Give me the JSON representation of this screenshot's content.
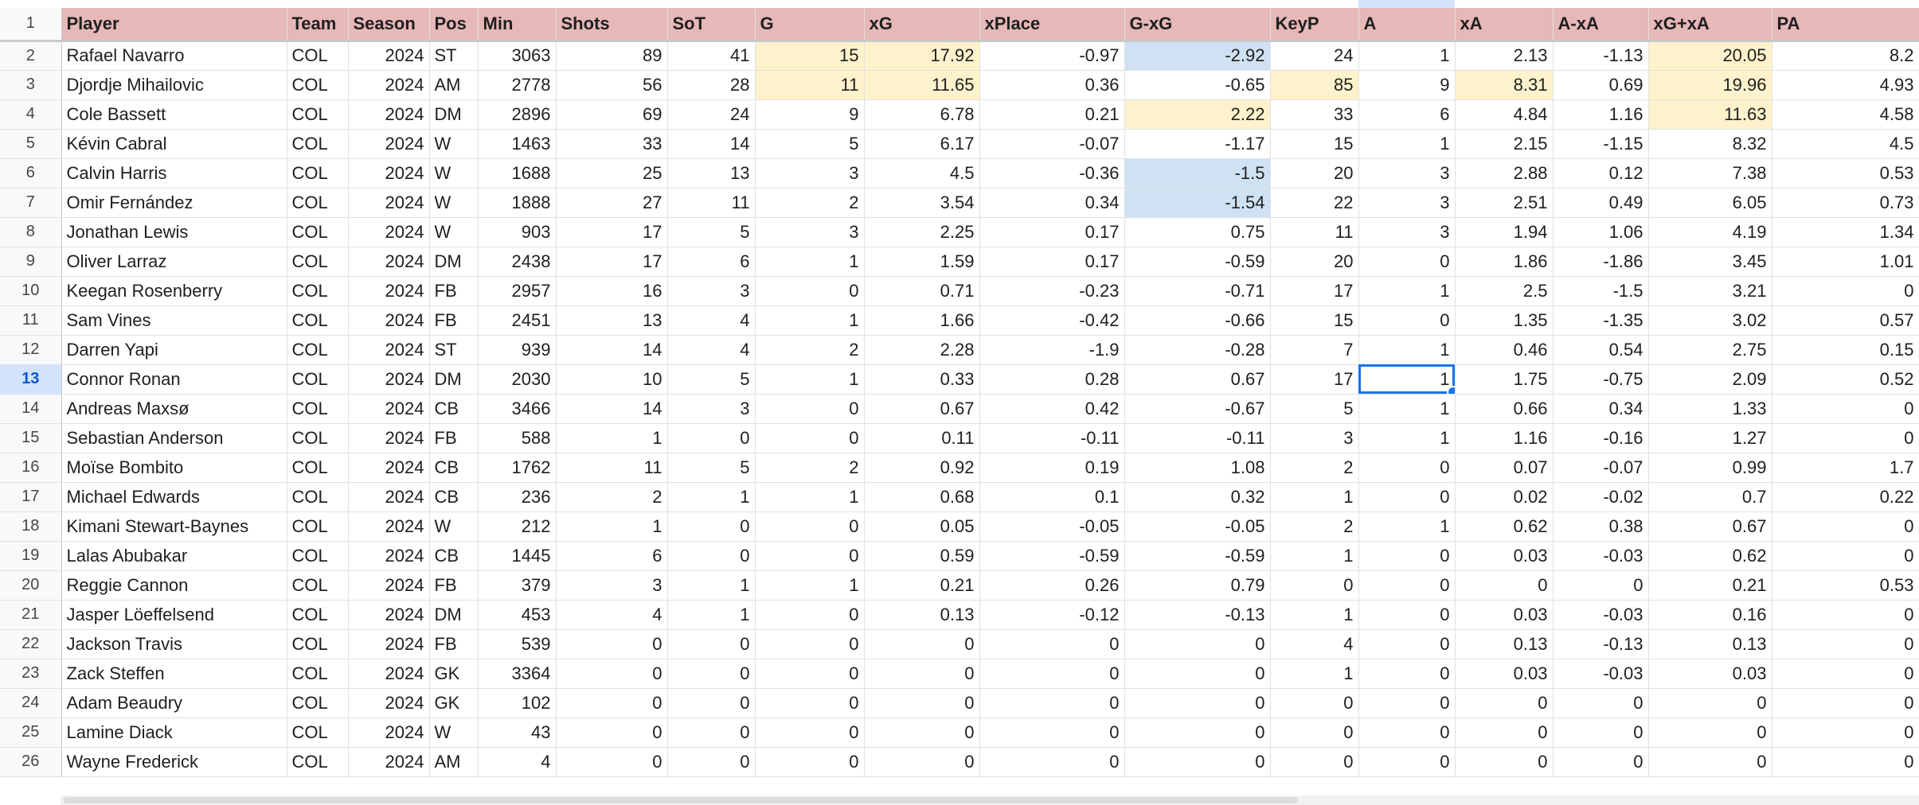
{
  "headers": [
    "Player",
    "Team",
    "Season",
    "Pos",
    "Min",
    "Shots",
    "SoT",
    "G",
    "xG",
    "xPlace",
    "G-xG",
    "KeyP",
    "A",
    "xA",
    "A-xA",
    "xG+xA",
    "PA"
  ],
  "header_row_number": "1",
  "active_row": "13",
  "selected_cell": {
    "row": "13",
    "column": "A"
  },
  "highlight_colors": {
    "header": "#e6b8b7",
    "yellow": "#fdf2cc",
    "blue": "#cfe2f3",
    "selection": "#1a73e8"
  },
  "rows": [
    {
      "num": "2",
      "cells": [
        "Rafael Navarro",
        "COL",
        "2024",
        "ST",
        "3063",
        "89",
        "41",
        "15",
        "17.92",
        "-0.97",
        "-2.92",
        "24",
        "1",
        "2.13",
        "-1.13",
        "20.05",
        "8.2"
      ]
    },
    {
      "num": "3",
      "cells": [
        "Djordje Mihailovic",
        "COL",
        "2024",
        "AM",
        "2778",
        "56",
        "28",
        "11",
        "11.65",
        "0.36",
        "-0.65",
        "85",
        "9",
        "8.31",
        "0.69",
        "19.96",
        "4.93"
      ]
    },
    {
      "num": "4",
      "cells": [
        "Cole Bassett",
        "COL",
        "2024",
        "DM",
        "2896",
        "69",
        "24",
        "9",
        "6.78",
        "0.21",
        "2.22",
        "33",
        "6",
        "4.84",
        "1.16",
        "11.63",
        "4.58"
      ]
    },
    {
      "num": "5",
      "cells": [
        "Kévin Cabral",
        "COL",
        "2024",
        "W",
        "1463",
        "33",
        "14",
        "5",
        "6.17",
        "-0.07",
        "-1.17",
        "15",
        "1",
        "2.15",
        "-1.15",
        "8.32",
        "4.5"
      ]
    },
    {
      "num": "6",
      "cells": [
        "Calvin Harris",
        "COL",
        "2024",
        "W",
        "1688",
        "25",
        "13",
        "3",
        "4.5",
        "-0.36",
        "-1.5",
        "20",
        "3",
        "2.88",
        "0.12",
        "7.38",
        "0.53"
      ]
    },
    {
      "num": "7",
      "cells": [
        "Omir Fernández",
        "COL",
        "2024",
        "W",
        "1888",
        "27",
        "11",
        "2",
        "3.54",
        "0.34",
        "-1.54",
        "22",
        "3",
        "2.51",
        "0.49",
        "6.05",
        "0.73"
      ]
    },
    {
      "num": "8",
      "cells": [
        "Jonathan Lewis",
        "COL",
        "2024",
        "W",
        "903",
        "17",
        "5",
        "3",
        "2.25",
        "0.17",
        "0.75",
        "11",
        "3",
        "1.94",
        "1.06",
        "4.19",
        "1.34"
      ]
    },
    {
      "num": "9",
      "cells": [
        "Oliver Larraz",
        "COL",
        "2024",
        "DM",
        "2438",
        "17",
        "6",
        "1",
        "1.59",
        "0.17",
        "-0.59",
        "20",
        "0",
        "1.86",
        "-1.86",
        "3.45",
        "1.01"
      ]
    },
    {
      "num": "10",
      "cells": [
        "Keegan Rosenberry",
        "COL",
        "2024",
        "FB",
        "2957",
        "16",
        "3",
        "0",
        "0.71",
        "-0.23",
        "-0.71",
        "17",
        "1",
        "2.5",
        "-1.5",
        "3.21",
        "0"
      ]
    },
    {
      "num": "11",
      "cells": [
        "Sam Vines",
        "COL",
        "2024",
        "FB",
        "2451",
        "13",
        "4",
        "1",
        "1.66",
        "-0.42",
        "-0.66",
        "15",
        "0",
        "1.35",
        "-1.35",
        "3.02",
        "0.57"
      ]
    },
    {
      "num": "12",
      "cells": [
        "Darren Yapi",
        "COL",
        "2024",
        "ST",
        "939",
        "14",
        "4",
        "2",
        "2.28",
        "-1.9",
        "-0.28",
        "7",
        "1",
        "0.46",
        "0.54",
        "2.75",
        "0.15"
      ]
    },
    {
      "num": "13",
      "cells": [
        "Connor Ronan",
        "COL",
        "2024",
        "DM",
        "2030",
        "10",
        "5",
        "1",
        "0.33",
        "0.28",
        "0.67",
        "17",
        "1",
        "1.75",
        "-0.75",
        "2.09",
        "0.52"
      ]
    },
    {
      "num": "14",
      "cells": [
        "Andreas Maxsø",
        "COL",
        "2024",
        "CB",
        "3466",
        "14",
        "3",
        "0",
        "0.67",
        "0.42",
        "-0.67",
        "5",
        "1",
        "0.66",
        "0.34",
        "1.33",
        "0"
      ]
    },
    {
      "num": "15",
      "cells": [
        "Sebastian Anderson",
        "COL",
        "2024",
        "FB",
        "588",
        "1",
        "0",
        "0",
        "0.11",
        "-0.11",
        "-0.11",
        "3",
        "1",
        "1.16",
        "-0.16",
        "1.27",
        "0"
      ]
    },
    {
      "num": "16",
      "cells": [
        "Moïse Bombito",
        "COL",
        "2024",
        "CB",
        "1762",
        "11",
        "5",
        "2",
        "0.92",
        "0.19",
        "1.08",
        "2",
        "0",
        "0.07",
        "-0.07",
        "0.99",
        "1.7"
      ]
    },
    {
      "num": "17",
      "cells": [
        "Michael Edwards",
        "COL",
        "2024",
        "CB",
        "236",
        "2",
        "1",
        "1",
        "0.68",
        "0.1",
        "0.32",
        "1",
        "0",
        "0.02",
        "-0.02",
        "0.7",
        "0.22"
      ]
    },
    {
      "num": "18",
      "cells": [
        "Kimani Stewart-Baynes",
        "COL",
        "2024",
        "W",
        "212",
        "1",
        "0",
        "0",
        "0.05",
        "-0.05",
        "-0.05",
        "2",
        "1",
        "0.62",
        "0.38",
        "0.67",
        "0"
      ]
    },
    {
      "num": "19",
      "cells": [
        "Lalas Abubakar",
        "COL",
        "2024",
        "CB",
        "1445",
        "6",
        "0",
        "0",
        "0.59",
        "-0.59",
        "-0.59",
        "1",
        "0",
        "0.03",
        "-0.03",
        "0.62",
        "0"
      ]
    },
    {
      "num": "20",
      "cells": [
        "Reggie Cannon",
        "COL",
        "2024",
        "FB",
        "379",
        "3",
        "1",
        "1",
        "0.21",
        "0.26",
        "0.79",
        "0",
        "0",
        "0",
        "0",
        "0.21",
        "0.53"
      ]
    },
    {
      "num": "21",
      "cells": [
        "Jasper Löeffelsend",
        "COL",
        "2024",
        "DM",
        "453",
        "4",
        "1",
        "0",
        "0.13",
        "-0.12",
        "-0.13",
        "1",
        "0",
        "0.03",
        "-0.03",
        "0.16",
        "0"
      ]
    },
    {
      "num": "22",
      "cells": [
        "Jackson Travis",
        "COL",
        "2024",
        "FB",
        "539",
        "0",
        "0",
        "0",
        "0",
        "0",
        "0",
        "4",
        "0",
        "0.13",
        "-0.13",
        "0.13",
        "0"
      ]
    },
    {
      "num": "23",
      "cells": [
        "Zack Steffen",
        "COL",
        "2024",
        "GK",
        "3364",
        "0",
        "0",
        "0",
        "0",
        "0",
        "0",
        "1",
        "0",
        "0.03",
        "-0.03",
        "0.03",
        "0"
      ]
    },
    {
      "num": "24",
      "cells": [
        "Adam Beaudry",
        "COL",
        "2024",
        "GK",
        "102",
        "0",
        "0",
        "0",
        "0",
        "0",
        "0",
        "0",
        "0",
        "0",
        "0",
        "0",
        "0"
      ]
    },
    {
      "num": "25",
      "cells": [
        "Lamine Diack",
        "COL",
        "2024",
        "W",
        "43",
        "0",
        "0",
        "0",
        "0",
        "0",
        "0",
        "0",
        "0",
        "0",
        "0",
        "0",
        "0"
      ]
    },
    {
      "num": "26",
      "cells": [
        "Wayne Frederick",
        "COL",
        "2024",
        "AM",
        "4",
        "0",
        "0",
        "0",
        "0",
        "0",
        "0",
        "0",
        "0",
        "0",
        "0",
        "0",
        "0"
      ]
    }
  ]
}
